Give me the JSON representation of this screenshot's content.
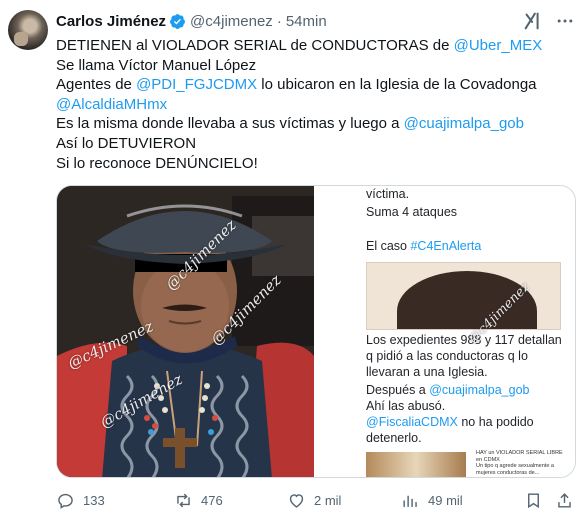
{
  "author": {
    "name": "Carlos Jiménez",
    "handle": "@c4jimenez",
    "separator": "·",
    "time": "54min",
    "verified": true
  },
  "tweet": {
    "lines": [
      {
        "pre": "DETIENEN al VIOLADOR SERIAL de CONDUCTORAS de ",
        "link": "@Uber_MEX",
        "post": ""
      },
      {
        "pre": "Se llama  Víctor Manuel López",
        "link": "",
        "post": ""
      },
      {
        "pre": "Agentes de ",
        "link": "@PDI_FGJCDMX",
        "post": " lo ubicaron en la Iglesia de la Covadonga"
      },
      {
        "pre": "",
        "link": "@AlcaldiaMHmx",
        "post": ""
      },
      {
        "pre": "Es la misma donde llevaba a sus víctimas y luego a ",
        "link": "@cuajimalpa_gob",
        "post": ""
      },
      {
        "pre": "Así lo DETUVIERON",
        "link": "",
        "post": ""
      },
      {
        "pre": "Si lo reconoce DENÚNCIELO!",
        "link": "",
        "post": ""
      }
    ]
  },
  "media": {
    "watermark": "@c4jimenez",
    "screenshot": {
      "top_line_1": "víctima.",
      "top_line_2": "Suma 4 ataques",
      "caso_pre": "El caso ",
      "caso_link": "#C4EnAlerta",
      "body_1": "Los expedientes 988 y 117  detallan",
      "body_2": "q  pidió a las conductoras q lo",
      "body_3": "llevaran a una Iglesia.",
      "body_4_pre": "Después a ",
      "body_4_link": "@cuajimalpa_gob",
      "body_5": "Ahí las abusó.",
      "body_6_link": "@FiscaliaCDMX",
      "body_6_post": " no ha podido",
      "body_7": "detenerlo.",
      "mini_1": "HAY un VIOLADOR SERIAL LIBRE",
      "mini_2": "en CDMX",
      "mini_3": "Un tipo q agrede sexualmente a",
      "mini_4": "mujeres conductoras de..."
    }
  },
  "actions": {
    "replies": "133",
    "reposts": "476",
    "likes": "2 mil",
    "views": "49 mil"
  },
  "colors": {
    "link": "#1d9bf0",
    "muted": "#536471",
    "text": "#0f1419",
    "verified": "#1d9bf0"
  },
  "icons": [
    "verified-badge-icon",
    "grok-icon",
    "more-icon",
    "reply-icon",
    "repost-icon",
    "like-icon",
    "views-icon",
    "bookmark-icon",
    "share-icon"
  ]
}
